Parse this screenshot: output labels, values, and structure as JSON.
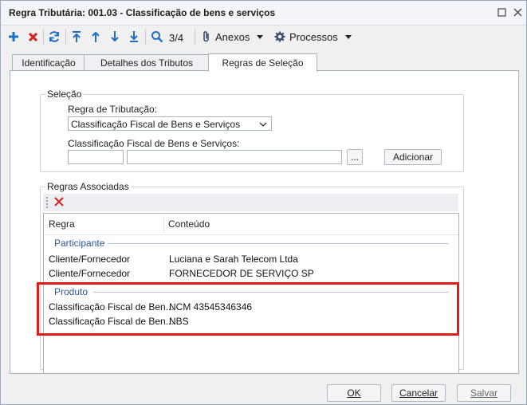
{
  "window": {
    "title": "Regra Tributária: 001.03 - Classificação de bens e serviços"
  },
  "toolbar": {
    "page_indicator": "3/4",
    "anexos_label": "Anexos",
    "processos_label": "Processos"
  },
  "tabs": [
    {
      "label": "Identificação"
    },
    {
      "label": "Detalhes dos Tributos"
    },
    {
      "label": "Regras de Seleção"
    }
  ],
  "selecao": {
    "group_title": "Seleção",
    "regra_label": "Regra de Tributação:",
    "regra_value": "Classificação Fiscal de Bens e Serviços",
    "classificacao_label": "Classificação Fiscal de Bens e Serviços:",
    "browse_label": "...",
    "adicionar_label": "Adicionar"
  },
  "regras": {
    "group_title": "Regras Associadas",
    "columns": [
      "Regra",
      "Conteúdo"
    ],
    "groups": [
      {
        "name": "Participante",
        "rows": [
          {
            "regra": "Cliente/Fornecedor",
            "conteudo": "Luciana e Sarah Telecom Ltda"
          },
          {
            "regra": "Cliente/Fornecedor",
            "conteudo": "FORNECEDOR DE SERVIÇO SP"
          }
        ]
      },
      {
        "name": "Produto",
        "rows": [
          {
            "regra": "Classificação Fiscal de Ben...",
            "conteudo": "NCM 43545346346"
          },
          {
            "regra": "Classificação Fiscal de Ben...",
            "conteudo": "NBS"
          }
        ]
      }
    ]
  },
  "footer": {
    "ok_label": "OK",
    "cancelar_label": "Cancelar",
    "salvar_label": "Salvar"
  },
  "colors": {
    "accent_blue": "#1f6fc5",
    "delete_red": "#d91f1f",
    "highlight_red": "#e11a1a"
  }
}
